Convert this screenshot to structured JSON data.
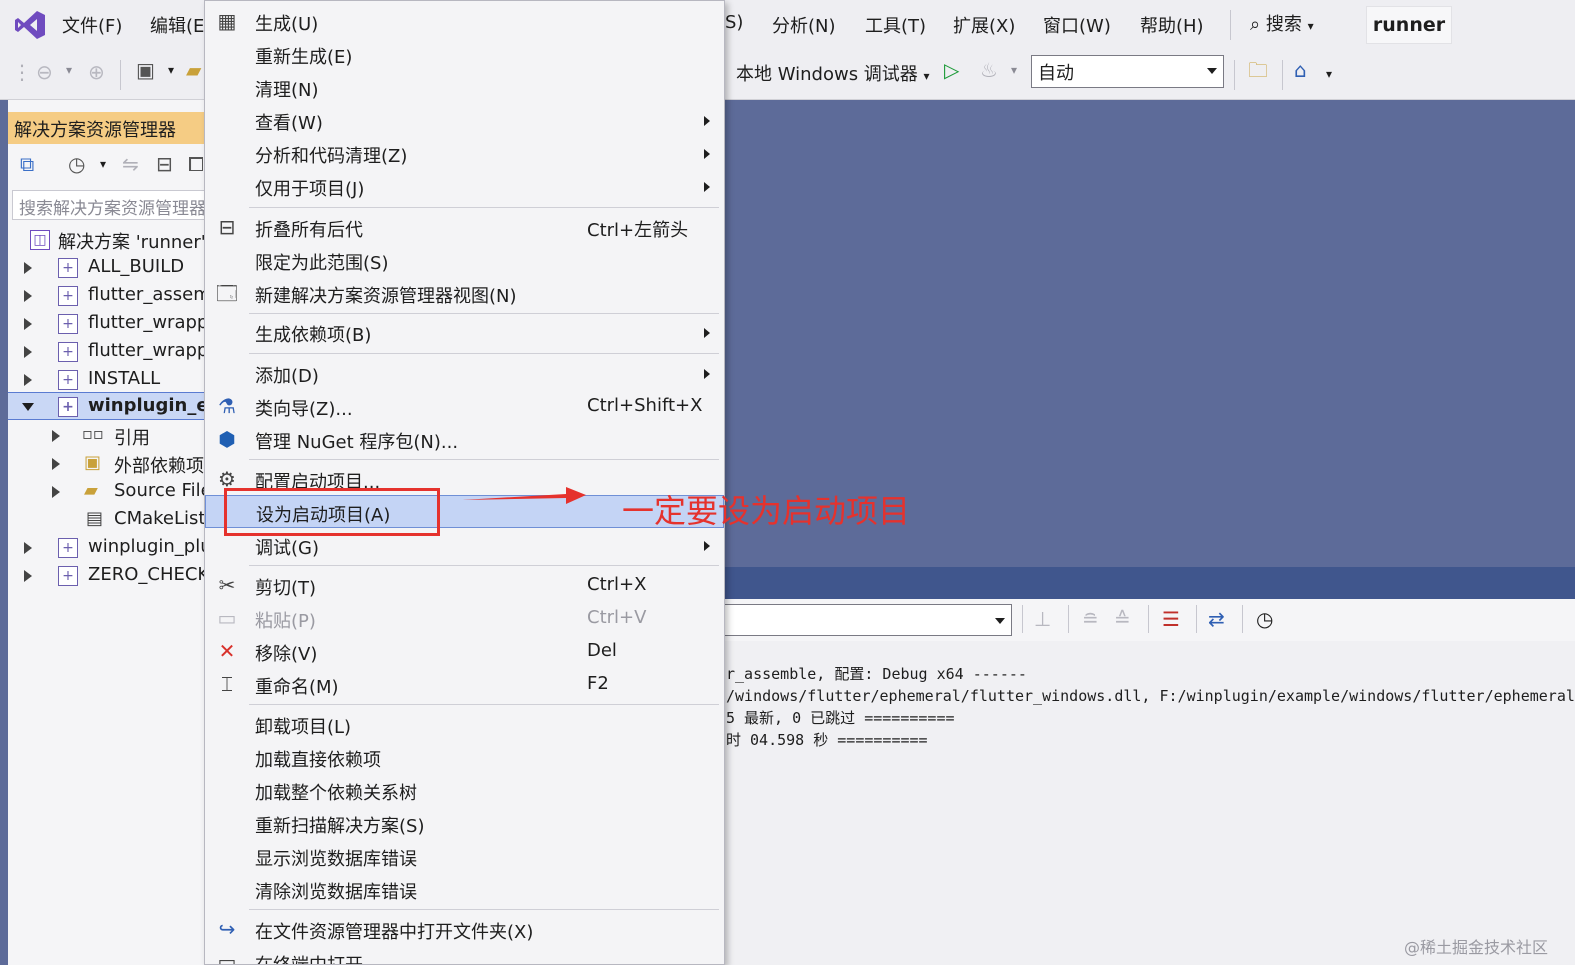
{
  "menubar": {
    "items": [
      "文件(F)",
      "编辑(E",
      "S)",
      "分析(N)",
      "工具(T)",
      "扩展(X)",
      "窗口(W)",
      "帮助(H)"
    ],
    "search_label": "搜索",
    "solution_badge": "runner"
  },
  "toolbar": {
    "debugger_label": "本地 Windows 调试器",
    "config_value": "自动"
  },
  "solution_explorer": {
    "title": "解决方案资源管理器",
    "search_placeholder": "搜索解决方案资源管理器",
    "tree": [
      {
        "label": "解决方案 'runner'",
        "level": 0,
        "expander": "none"
      },
      {
        "label": "ALL_BUILD",
        "level": 1,
        "expander": "collapsed"
      },
      {
        "label": "flutter_assem",
        "level": 1,
        "expander": "collapsed"
      },
      {
        "label": "flutter_wrapp",
        "level": 1,
        "expander": "collapsed"
      },
      {
        "label": "flutter_wrapp",
        "level": 1,
        "expander": "collapsed"
      },
      {
        "label": "INSTALL",
        "level": 1,
        "expander": "collapsed"
      },
      {
        "label": "winplugin_ex",
        "level": 1,
        "expander": "expanded",
        "selected": true
      },
      {
        "label": "引用",
        "level": 2,
        "expander": "collapsed"
      },
      {
        "label": "外部依赖项",
        "level": 2,
        "expander": "collapsed"
      },
      {
        "label": "Source File",
        "level": 2,
        "expander": "collapsed"
      },
      {
        "label": "CMakeList",
        "level": 2,
        "expander": "none"
      },
      {
        "label": "winplugin_plu",
        "level": 1,
        "expander": "collapsed"
      },
      {
        "label": "ZERO_CHECK",
        "level": 1,
        "expander": "collapsed"
      }
    ]
  },
  "output": {
    "lines": [
      "r_assemble, 配置: Debug x64 ------",
      "/windows/flutter/ephemeral/flutter_windows.dll, F:/winplugin/example/windows/flutter/ephemeral",
      "5 最新, 0 已跳过 ==========",
      "时 04.598 秒 =========="
    ]
  },
  "context_menu": {
    "items": [
      {
        "label": "生成(U)",
        "icon": "build-icon"
      },
      {
        "label": "重新生成(E)"
      },
      {
        "label": "清理(N)"
      },
      {
        "label": "查看(W)",
        "submenu": true
      },
      {
        "label": "分析和代码清理(Z)",
        "submenu": true
      },
      {
        "label": "仅用于项目(J)",
        "submenu": true
      },
      {
        "label": "折叠所有后代",
        "shortcut": "Ctrl+左箭头",
        "icon": "collapse-icon"
      },
      {
        "label": "限定为此范围(S)"
      },
      {
        "label": "新建解决方案资源管理器视图(N)",
        "icon": "new-view-icon"
      },
      {
        "label": "生成依赖项(B)",
        "submenu": true
      },
      {
        "label": "添加(D)",
        "submenu": true
      },
      {
        "label": "类向导(Z)...",
        "shortcut": "Ctrl+Shift+X",
        "icon": "class-wizard-icon"
      },
      {
        "label": "管理 NuGet 程序包(N)...",
        "icon": "nuget-icon"
      },
      {
        "label": "配置启动项目...",
        "icon": "gear-icon"
      },
      {
        "label": "设为启动项目(A)",
        "highlight": true
      },
      {
        "label": "调试(G)",
        "submenu": true
      },
      {
        "label": "剪切(T)",
        "shortcut": "Ctrl+X",
        "icon": "scissors-icon"
      },
      {
        "label": "粘贴(P)",
        "shortcut": "Ctrl+V",
        "icon": "paste-icon",
        "disabled": true
      },
      {
        "label": "移除(V)",
        "shortcut": "Del",
        "icon": "delete-icon"
      },
      {
        "label": "重命名(M)",
        "shortcut": "F2",
        "icon": "rename-icon"
      },
      {
        "label": "卸载项目(L)"
      },
      {
        "label": "加载直接依赖项"
      },
      {
        "label": "加载整个依赖关系树"
      },
      {
        "label": "重新扫描解决方案(S)"
      },
      {
        "label": "显示浏览数据库错误"
      },
      {
        "label": "清除浏览数据库错误"
      },
      {
        "label": "在文件资源管理器中打开文件夹(X)",
        "icon": "open-folder-icon"
      },
      {
        "label": "在终端中打开",
        "icon": "terminal-icon"
      }
    ]
  },
  "annotation": {
    "text": "一定要设为启动项目"
  },
  "watermark": "@稀土掘金技术社区",
  "colors": {
    "accent": "#5d6b99",
    "highlight": "#c4d4f5",
    "annotation": "#e5322d",
    "title_bar": "#f5cc84"
  }
}
